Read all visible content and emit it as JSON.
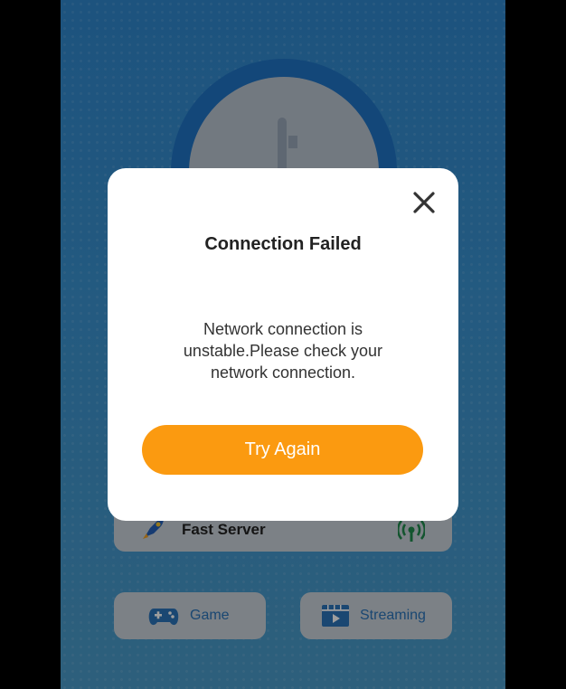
{
  "dialog": {
    "title": "Connection Failed",
    "message": "Network connection is unstable.Please check your network connection.",
    "primary_button": "Try Again",
    "close_icon": "close-icon"
  },
  "server_card": {
    "label": "Fast Server",
    "icons": [
      "rocket-icon",
      "signal-icon"
    ]
  },
  "tiles": [
    {
      "label": "Game",
      "icon": "gamepad-icon"
    },
    {
      "label": "Streaming",
      "icon": "video-play-icon"
    }
  ],
  "colors": {
    "background_blue": "#3a92cf",
    "ring_blue": "#1f73c4",
    "accent_orange": "#fb9a10",
    "tile_text_blue": "#2a73b8",
    "signal_green": "#1f8a4c"
  }
}
